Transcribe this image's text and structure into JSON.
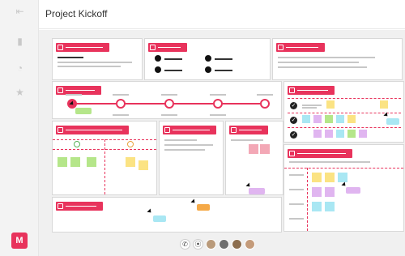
{
  "app": {
    "title": "Project Kickoff",
    "brand_letter": "M",
    "accent_color": "#e8335c"
  },
  "rail": {
    "items": [
      {
        "name": "back-icon",
        "glyph": "⇤"
      },
      {
        "name": "sticky-note-icon",
        "glyph": "▮"
      },
      {
        "name": "shapes-icon",
        "glyph": "◔"
      },
      {
        "name": "star-icon",
        "glyph": "★"
      }
    ]
  },
  "board": {
    "panels": [
      {
        "id": "folder",
        "icon": "folder-icon"
      },
      {
        "id": "people",
        "icon": "person-card-icon"
      },
      {
        "id": "chart",
        "icon": "bar-chart-icon"
      },
      {
        "id": "timeline",
        "icon": "calendar-icon"
      },
      {
        "id": "targets",
        "icon": "target-icon"
      },
      {
        "id": "feedback",
        "icon": "smiley-icon"
      },
      {
        "id": "scope",
        "icon": "scope-icon"
      },
      {
        "id": "risks",
        "icon": "warning-icon"
      },
      {
        "id": "team",
        "icon": "group-icon"
      },
      {
        "id": "notes",
        "icon": "note-icon"
      }
    ],
    "collaborators": [
      {
        "name": "call-icon"
      },
      {
        "name": "video-icon"
      },
      {
        "name": "collaborator-avatar-1"
      },
      {
        "name": "collaborator-avatar-2"
      },
      {
        "name": "collaborator-avatar-3"
      },
      {
        "name": "collaborator-avatar-4"
      }
    ]
  }
}
